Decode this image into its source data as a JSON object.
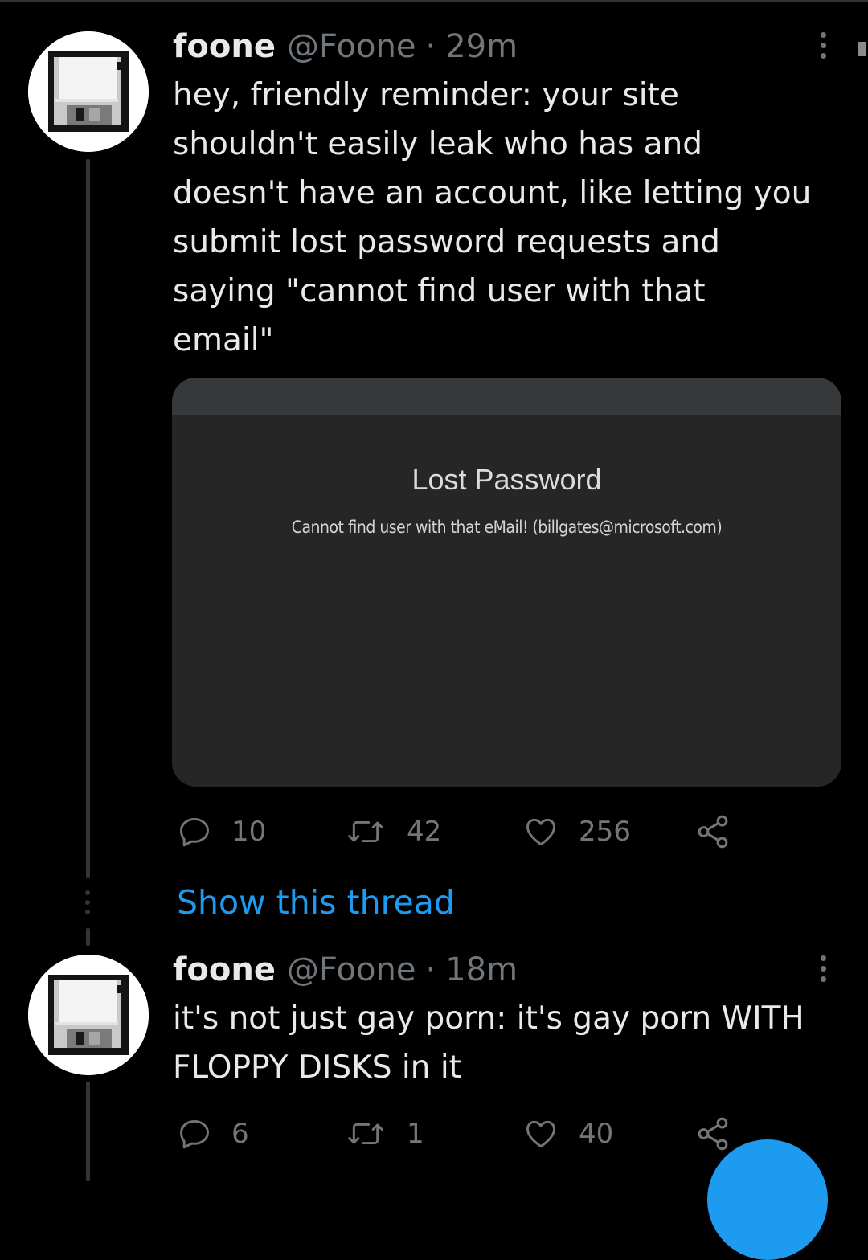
{
  "colors": {
    "background": "#000000",
    "text_primary": "#E7E9EA",
    "text_secondary": "#71767B",
    "accent": "#1D9BF0",
    "thread_line": "#333639",
    "media_background": "#262626"
  },
  "tweets": [
    {
      "display_name": "foone",
      "handle": "@Foone",
      "separator": "·",
      "time": "29m",
      "avatar_icon": "floppy-disk-icon",
      "text": "hey, friendly reminder: your site\nshouldn't easily leak who has and\ndoesn't have an account, like letting you\nsubmit lost password requests and\nsaying \"cannot find user with that\nemail\"",
      "media": {
        "title": "Lost Password",
        "message": "Cannot find user with that eMail! (billgates@microsoft.com)"
      },
      "stats": {
        "replies": "10",
        "retweets": "42",
        "likes": "256"
      }
    },
    {
      "display_name": "foone",
      "handle": "@Foone",
      "separator": "·",
      "time": "18m",
      "avatar_icon": "floppy-disk-icon",
      "text": "it's not just gay porn: it's gay porn WITH\nFLOPPY DISKS in it",
      "stats": {
        "replies": "6",
        "retweets": "1",
        "likes": "40"
      }
    }
  ],
  "show_thread_label": "Show this thread",
  "icons": {
    "reply": "reply-icon",
    "retweet": "retweet-icon",
    "like": "heart-icon",
    "share": "share-icon",
    "more": "more-vertical-icon",
    "compose": "compose-button"
  }
}
